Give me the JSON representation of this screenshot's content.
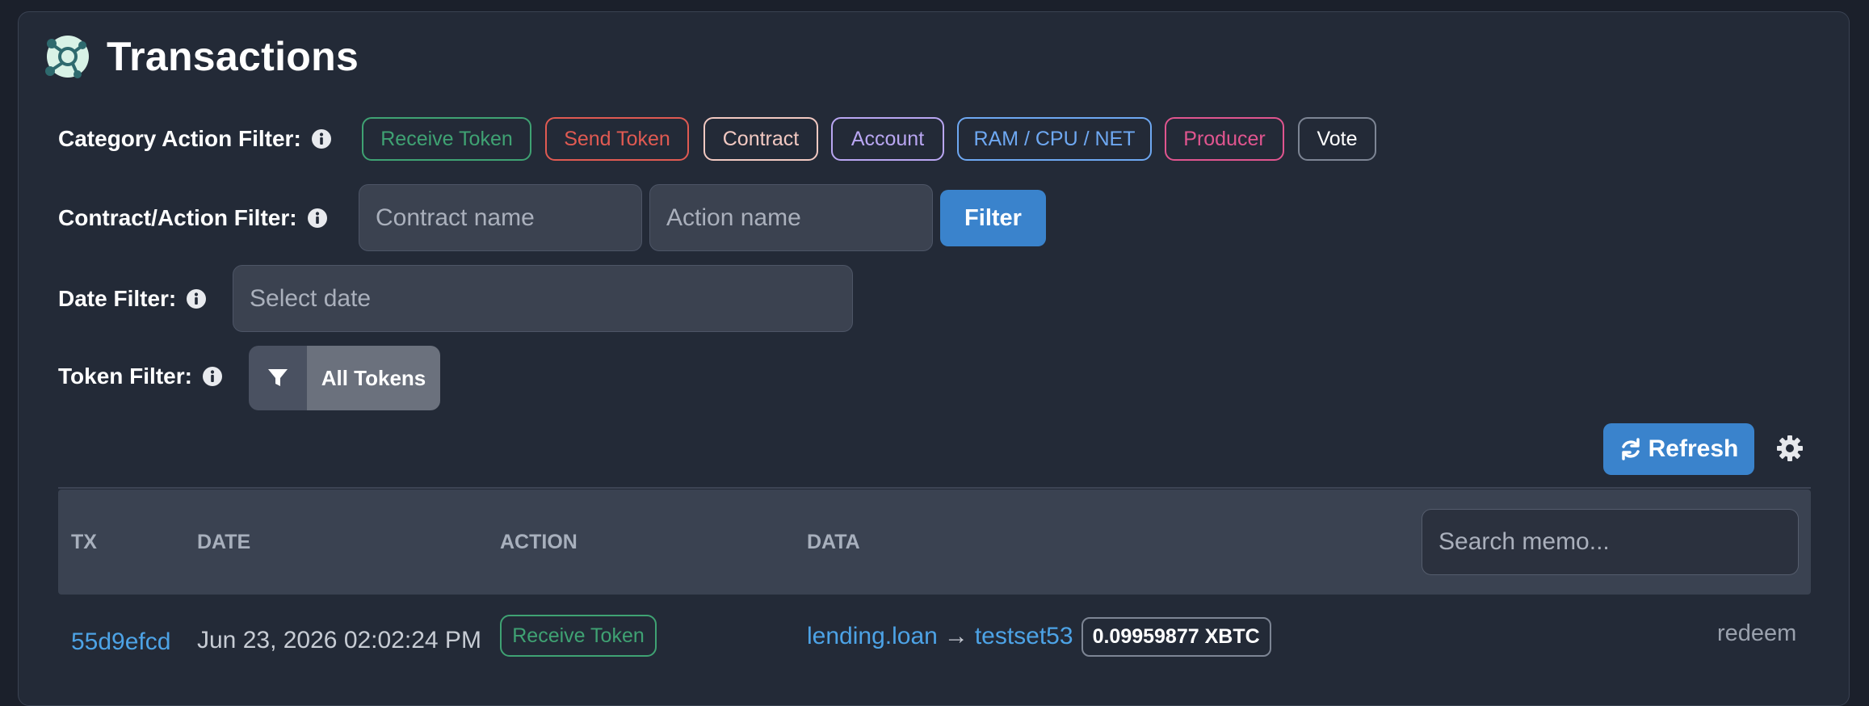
{
  "header": {
    "title": "Transactions"
  },
  "filters": {
    "category_label": "Category Action Filter:",
    "categories": [
      {
        "label": "Receive Token",
        "color": "#3fa273"
      },
      {
        "label": "Send Token",
        "color": "#e05a52"
      },
      {
        "label": "Contract",
        "color": "#f2c9c2"
      },
      {
        "label": "Account",
        "color": "#b9a6f2"
      },
      {
        "label": "RAM / CPU / NET",
        "color": "#6ea8f2"
      },
      {
        "label": "Producer",
        "color": "#e0558f"
      },
      {
        "label": "Vote",
        "color": "#7d8594"
      }
    ],
    "contract_action_label": "Contract/Action Filter:",
    "contract_placeholder": "Contract name",
    "action_placeholder": "Action name",
    "filter_button": "Filter",
    "date_label": "Date Filter:",
    "date_placeholder": "Select date",
    "token_label": "Token Filter:",
    "token_button": "All Tokens"
  },
  "toolbar": {
    "refresh_label": "Refresh"
  },
  "table": {
    "columns": [
      "TX",
      "DATE",
      "ACTION",
      "DATA"
    ],
    "search_placeholder": "Search memo...",
    "rows": [
      {
        "tx": "55d9efcd",
        "date": "Jun 23, 2026 02:02:24 PM",
        "action": "Receive Token",
        "from": "lending.loan",
        "arrow": "→",
        "to": "testset53",
        "amount": "0.09959877 XBTC",
        "memo": "redeem"
      }
    ]
  },
  "colors": {
    "accent": "#3a83cc",
    "link": "#4da3e6",
    "receive": "#3fa273"
  }
}
